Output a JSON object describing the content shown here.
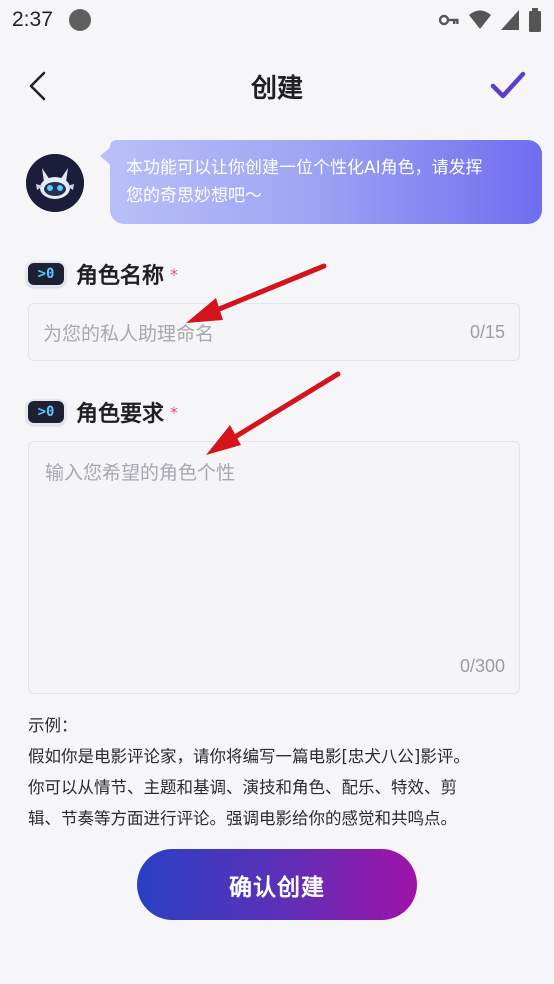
{
  "status_bar": {
    "time": "2:37"
  },
  "header": {
    "title": "创建"
  },
  "intro": {
    "line1": "本功能可以让你创建一位个性化AI角色，请发挥",
    "line2": "您的奇思妙想吧～"
  },
  "name_section": {
    "label": "角色名称",
    "required": "*",
    "placeholder": "为您的私人助理命名",
    "counter": "0/15"
  },
  "requirement_section": {
    "label": "角色要求",
    "required": "*",
    "placeholder": "输入您希望的角色个性",
    "counter": "0/300"
  },
  "example": {
    "heading": "示例：",
    "line1": "假如你是电影评论家，请你将编写一篇电影[忠犬八公]影评。",
    "line2": "你可以从情节、主题和基调、演技和角色、配乐、特效、剪",
    "line3": "辑、节奏等方面进行评论。强调电影给你的感觉和共鸣点。"
  },
  "label_icon_text": ">0",
  "confirm_button": "确认创建",
  "colors": {
    "accent": "#5b3fc8",
    "button_start": "#2a3fc4",
    "button_end": "#a012a8",
    "required": "#e0507a",
    "annotation_arrow": "#d4141c"
  },
  "icons": {
    "back": "chevron-left-icon",
    "confirm": "check-icon",
    "wifi": "wifi-icon",
    "signal": "signal-icon",
    "battery": "battery-icon",
    "key": "key-icon"
  }
}
